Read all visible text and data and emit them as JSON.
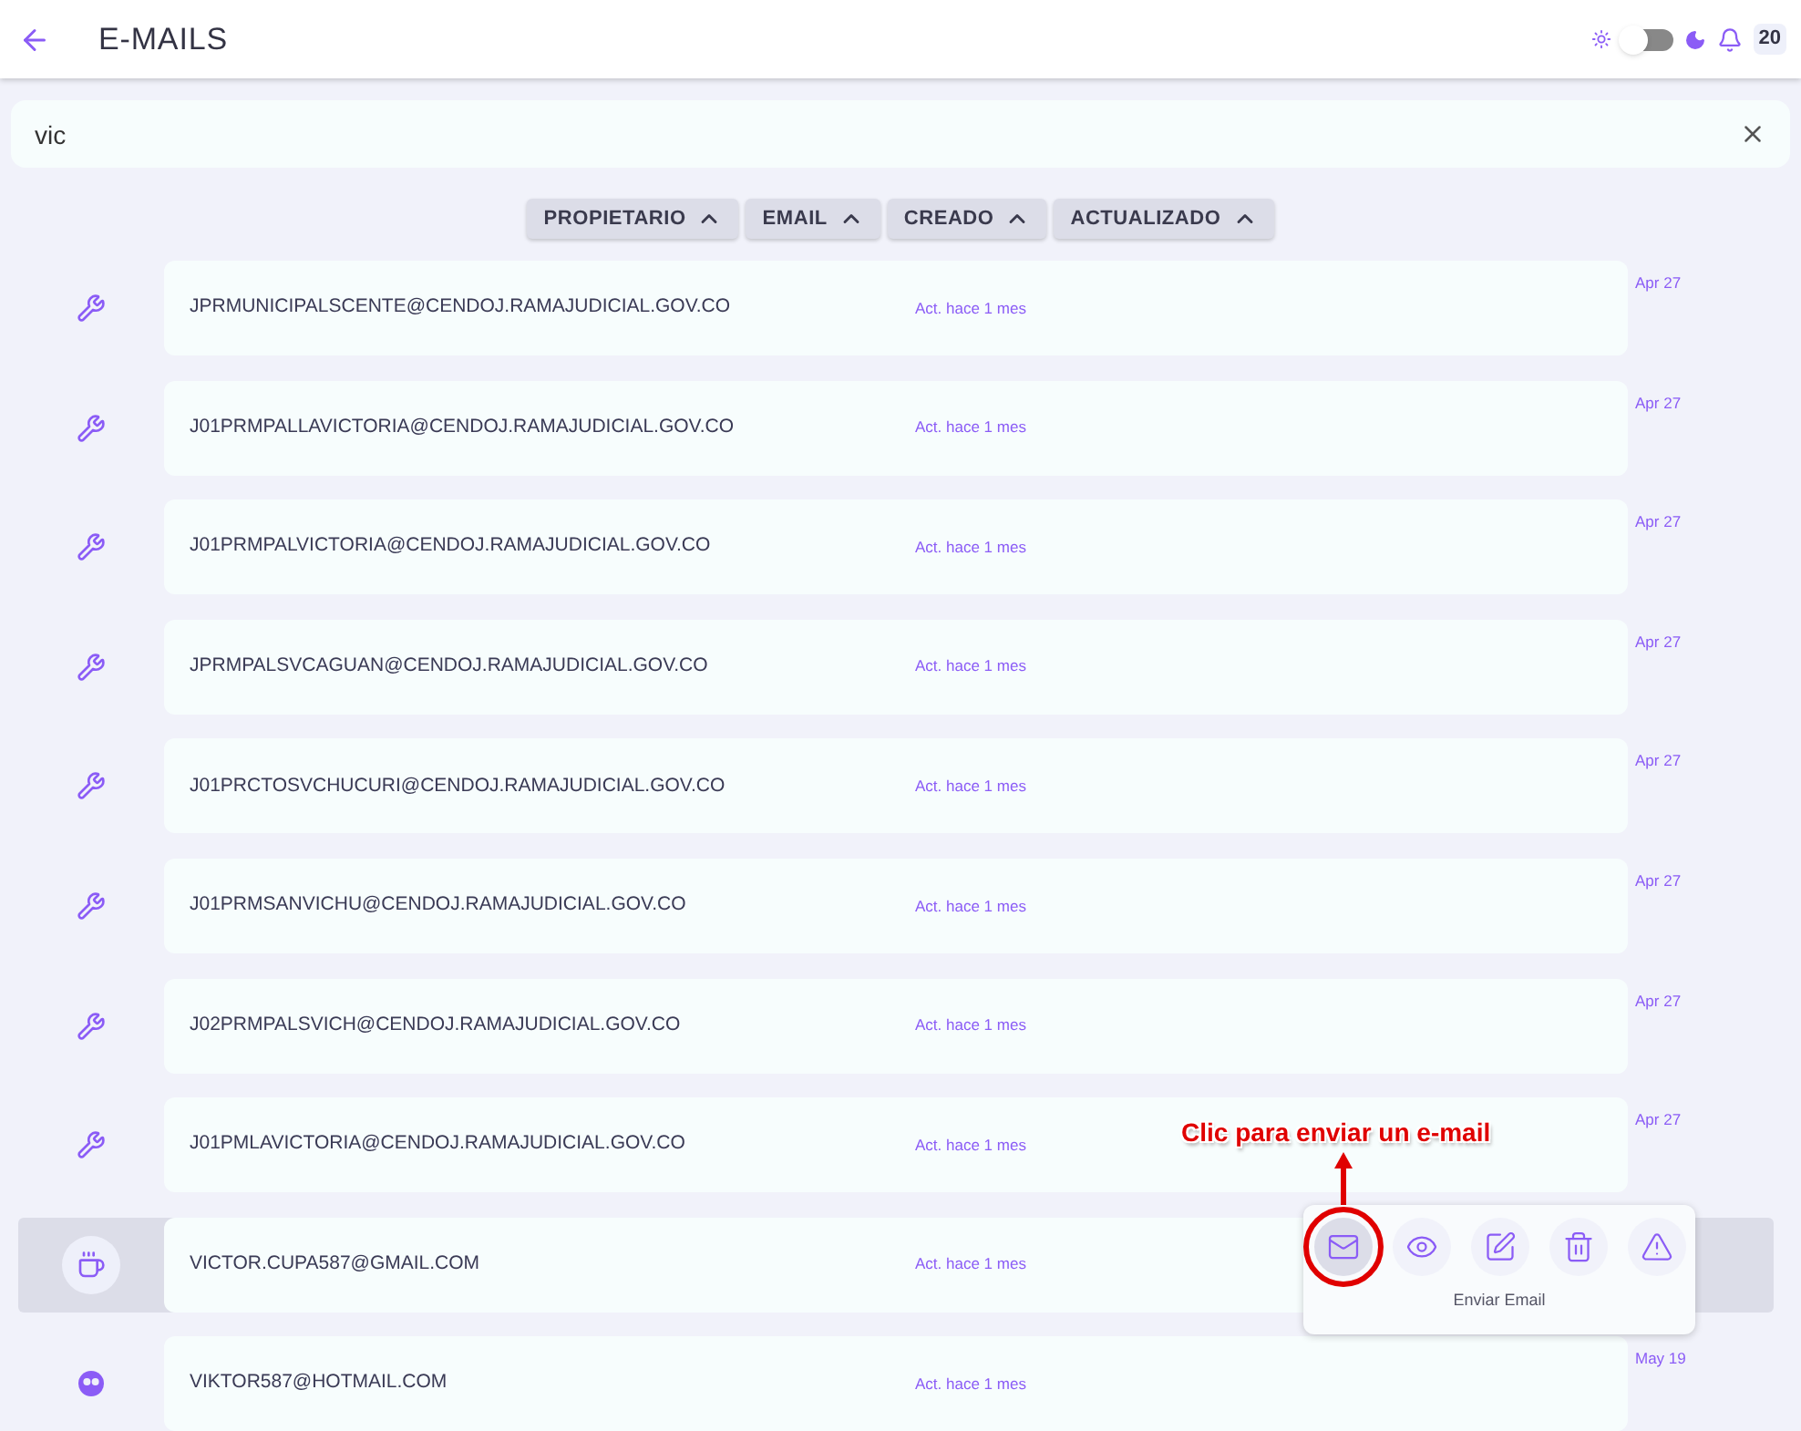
{
  "header": {
    "title": "E-MAILS",
    "dark_mode": false,
    "notifications": "20"
  },
  "search": {
    "value": "vic"
  },
  "sort_buttons": [
    {
      "label": "PROPIETARIO"
    },
    {
      "label": "EMAIL"
    },
    {
      "label": "CREADO"
    },
    {
      "label": "ACTUALIZADO"
    }
  ],
  "rows": [
    {
      "kind": "wrench",
      "email": "JPRMUNICIPALSCENTE@CENDOJ.RAMAJUDICIAL.GOV.CO",
      "updated": "Act. hace 1 mes",
      "date": "Apr 27",
      "selected": false
    },
    {
      "kind": "wrench",
      "email": "J01PRMPALLAVICTORIA@CENDOJ.RAMAJUDICIAL.GOV.CO",
      "updated": "Act. hace 1 mes",
      "date": "Apr 27",
      "selected": false
    },
    {
      "kind": "wrench",
      "email": "J01PRMPALVICTORIA@CENDOJ.RAMAJUDICIAL.GOV.CO",
      "updated": "Act. hace 1 mes",
      "date": "Apr 27",
      "selected": false
    },
    {
      "kind": "wrench",
      "email": "JPRMPALSVCAGUAN@CENDOJ.RAMAJUDICIAL.GOV.CO",
      "updated": "Act. hace 1 mes",
      "date": "Apr 27",
      "selected": false
    },
    {
      "kind": "wrench",
      "email": "J01PRCTOSVCHUCURI@CENDOJ.RAMAJUDICIAL.GOV.CO",
      "updated": "Act. hace 1 mes",
      "date": "Apr 27",
      "selected": false
    },
    {
      "kind": "wrench",
      "email": "J01PRMSANVICHU@CENDOJ.RAMAJUDICIAL.GOV.CO",
      "updated": "Act. hace 1 mes",
      "date": "Apr 27",
      "selected": false
    },
    {
      "kind": "wrench",
      "email": "J02PRMPALSVICH@CENDOJ.RAMAJUDICIAL.GOV.CO",
      "updated": "Act. hace 1 mes",
      "date": "Apr 27",
      "selected": false
    },
    {
      "kind": "wrench",
      "email": "J01PMLAVICTORIA@CENDOJ.RAMAJUDICIAL.GOV.CO",
      "updated": "Act. hace 1 mes",
      "date": "Apr 27",
      "selected": false
    },
    {
      "kind": "cup",
      "email": "VICTOR.CUPA587@GMAIL.COM",
      "updated": "Act. hace 1 mes",
      "selected": true
    },
    {
      "kind": "face",
      "email": "VIKTOR587@HOTMAIL.COM",
      "updated": "Act. hace 1 mes",
      "date": "May 19",
      "selected": false
    }
  ],
  "action_menu": {
    "actions": [
      {
        "kind": "mail",
        "selected": true
      },
      {
        "kind": "view",
        "selected": false
      },
      {
        "kind": "edit",
        "selected": false
      },
      {
        "kind": "delete",
        "selected": false
      },
      {
        "kind": "report",
        "selected": false
      }
    ],
    "tooltip": "Enviar Email"
  },
  "annotation": {
    "text": "Clic para enviar un e-mail"
  }
}
